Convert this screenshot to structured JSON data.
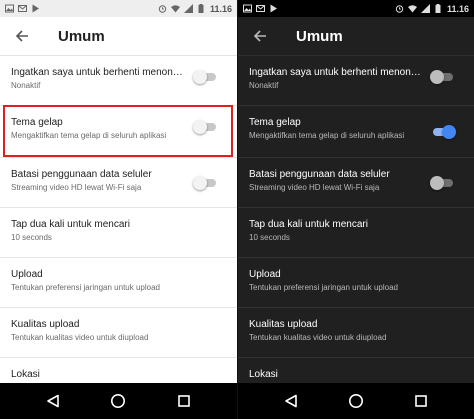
{
  "status_bar": {
    "time": "11.16",
    "icons": [
      "gallery-icon",
      "gmail-icon",
      "play-store-icon",
      "alarm-icon",
      "wifi-icon",
      "signal-icon",
      "battery-icon"
    ]
  },
  "app_bar": {
    "title": "Umum",
    "back_icon": "arrow-back-icon"
  },
  "settings": [
    {
      "title": "Ingatkan saya untuk berhenti menon…",
      "subtitle": "Nonaktif",
      "toggle": true
    },
    {
      "title": "Tema gelap",
      "subtitle": "Mengaktifkan tema gelap di seluruh aplikasi",
      "toggle": true
    },
    {
      "title": "Batasi penggunaan data seluler",
      "subtitle": "Streaming video HD lewat Wi-Fi saja",
      "toggle": true
    },
    {
      "title": "Tap dua kali untuk mencari",
      "subtitle": "10 seconds",
      "toggle": false
    },
    {
      "title": "Upload",
      "subtitle": "Tentukan preferensi jaringan untuk upload",
      "toggle": false
    },
    {
      "title": "Kualitas upload",
      "subtitle": "Tentukan kualitas video untuk diupload",
      "toggle": false
    },
    {
      "title": "Lokasi",
      "subtitle": "",
      "toggle": false
    }
  ],
  "light_screen": {
    "dark_theme_enabled": false
  },
  "dark_screen": {
    "dark_theme_enabled": true
  },
  "highlight_color": "#e02020",
  "accent_color": "#4285f4",
  "nav_bar": {
    "icons": [
      "back-triangle-icon",
      "home-circle-icon",
      "recents-square-icon"
    ]
  }
}
